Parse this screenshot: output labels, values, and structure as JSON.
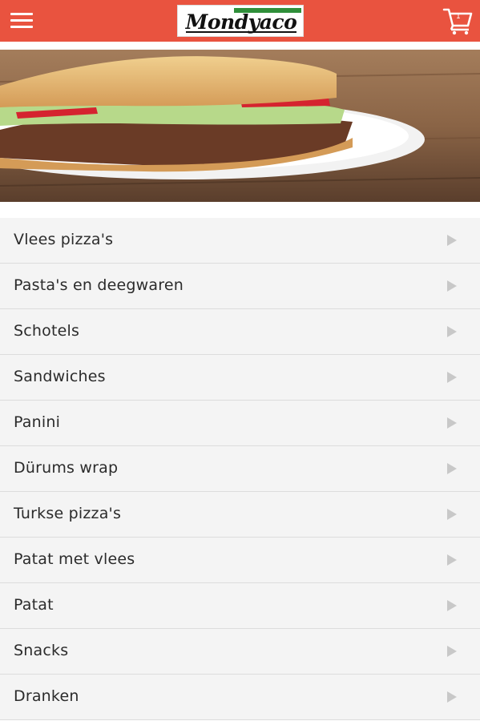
{
  "header": {
    "menu_icon": "hamburger-menu-icon",
    "logo_text": "Mondyaco",
    "cart_icon": "shopping-cart-icon",
    "cart_count": "1",
    "bar_color": "#e9533f"
  },
  "hero": {
    "image": "doner-sandwich-photo"
  },
  "menu": {
    "items": [
      {
        "label": "Vlees pizza's"
      },
      {
        "label": "Pasta's en deegwaren"
      },
      {
        "label": "Schotels"
      },
      {
        "label": "Sandwiches"
      },
      {
        "label": "Panini"
      },
      {
        "label": "Dürums wrap"
      },
      {
        "label": "Turkse pizza's"
      },
      {
        "label": "Patat met vlees"
      },
      {
        "label": "Patat"
      },
      {
        "label": "Snacks"
      },
      {
        "label": "Dranken"
      }
    ],
    "arrow_icon": "chevron-right-icon"
  }
}
